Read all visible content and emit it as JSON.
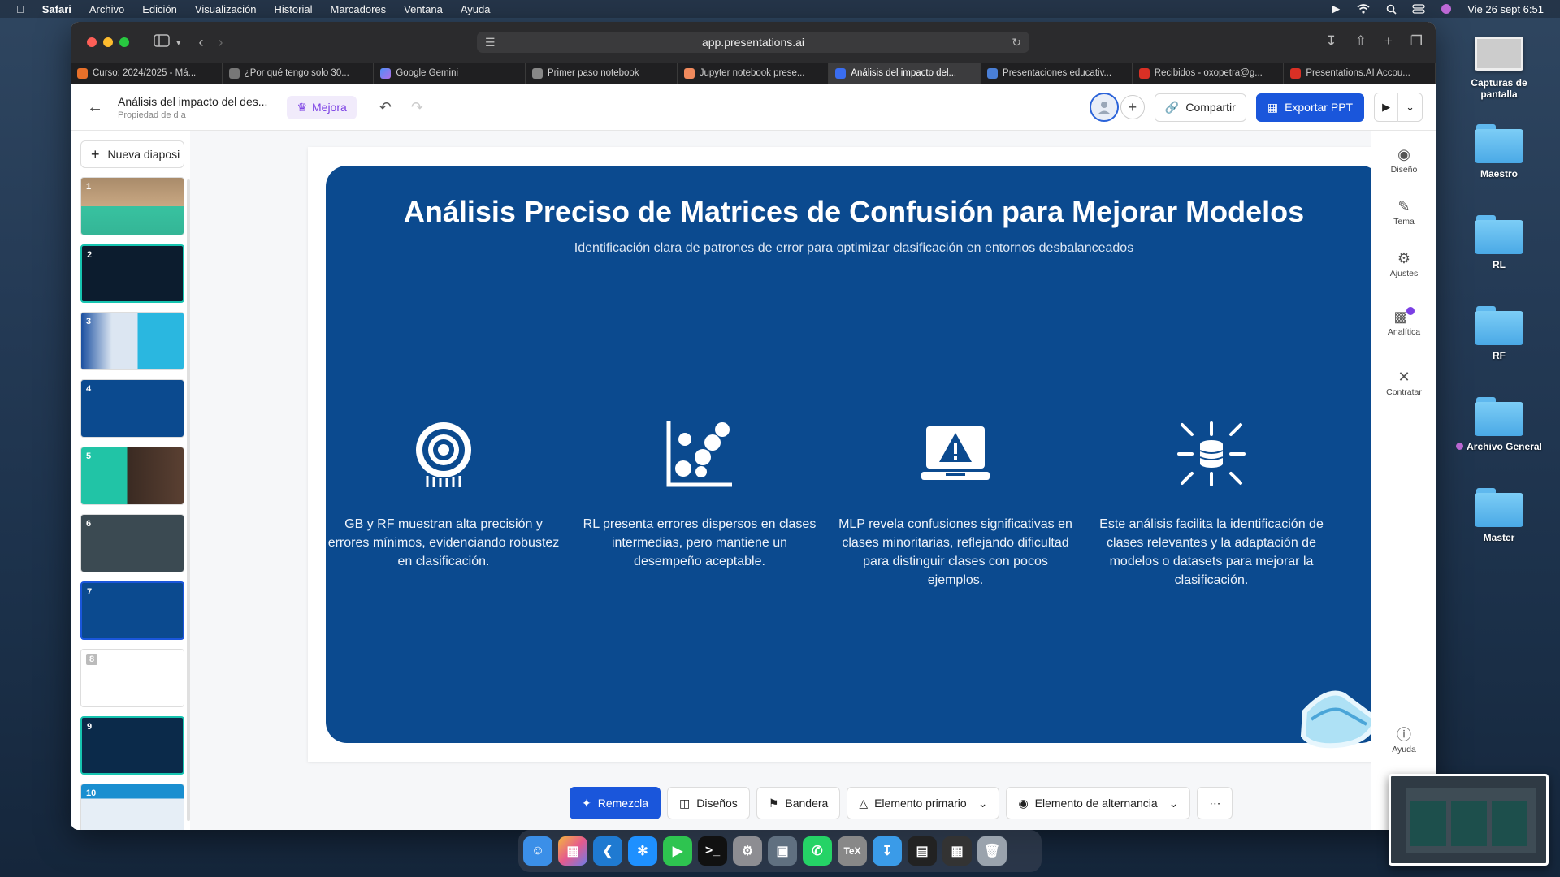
{
  "menubar": {
    "app": "Safari",
    "items": [
      "Archivo",
      "Edición",
      "Visualización",
      "Historial",
      "Marcadores",
      "Ventana",
      "Ayuda"
    ],
    "datetime": "Vie 26 sept 6:51"
  },
  "desktop": {
    "icons": [
      "Capturas de pantalla",
      "Maestro",
      "RL",
      "RF",
      "Archivo General",
      "Master"
    ]
  },
  "browser": {
    "url": "app.presentations.ai",
    "tabs": [
      "Curso: 2024/2025 - Má...",
      "¿Por qué tengo solo 30...",
      "Google Gemini",
      "Primer paso notebook",
      "Jupyter notebook prese...",
      "Análisis del impacto del...",
      "Presentaciones educativ...",
      "Recibidos - oxopetra@g...",
      "Presentations.AI Accou..."
    ]
  },
  "header": {
    "title": "Análisis del impacto del des...",
    "subtitle": "Propiedad de d a",
    "mejora": "Mejora",
    "share": "Compartir",
    "export": "Exportar PPT"
  },
  "sidebar": {
    "new_slide": "Nueva diaposi",
    "slides": [
      "1",
      "2",
      "3",
      "4",
      "5",
      "6",
      "7",
      "8",
      "9",
      "10"
    ]
  },
  "slide": {
    "title": "Análisis Preciso de Matrices de Confusión para Mejorar Modelos",
    "subtitle": "Identificación clara de patrones de error para optimizar clasificación en entornos desbalanceados",
    "columns": [
      {
        "icon": "target-icon",
        "text": "GB y RF muestran alta precisión y errores mínimos, evidenciando robustez en clasificación."
      },
      {
        "icon": "scatter-chart-icon",
        "text": "RL presenta errores dispersos en clases intermedias, pero mantiene un desempeño aceptable."
      },
      {
        "icon": "warning-laptop-icon",
        "text": "MLP revela confusiones significativas en clases minoritarias, reflejando dificultad para distinguir clases con pocos ejemplos."
      },
      {
        "icon": "database-arrows-icon",
        "text": "Este análisis facilita la identificación de clases relevantes y la adaptación de modelos o datasets para mejorar la clasificación."
      }
    ]
  },
  "right_tools": [
    "Diseño",
    "Tema",
    "Ajustes",
    "Analítica",
    "Contratar",
    "Ayuda"
  ],
  "bottom_toolbar": {
    "remix": "Remezcla",
    "layouts": "Diseños",
    "flag": "Bandera",
    "primary": "Elemento primario",
    "toggle": "Elemento de alternancia"
  },
  "colors": {
    "slide_bg": "#0b4a8f",
    "accent": "#1a56db",
    "mejora": "#7b3fe4"
  }
}
